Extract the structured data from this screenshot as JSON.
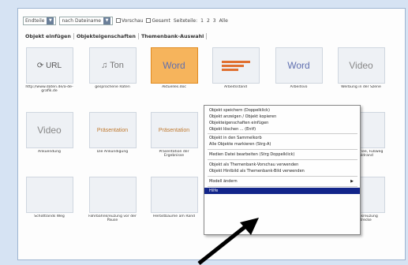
{
  "toolbar": {
    "sort_value": "Endteile",
    "order_value": "nach Dateiname",
    "checkbox_1": "Vorschau",
    "checkbox_2": "Gesamt",
    "pages_label": "Seiteteile:",
    "pages": [
      "1",
      "2",
      "3"
    ],
    "all_label": "Alle"
  },
  "tabs": [
    "Objekt einfügen",
    "Objekteigenschaften",
    "Themenbank-Auswahl"
  ],
  "tiles": [
    {
      "label": "http://www.daten.de/a-de-grafik.de",
      "icon": "URL"
    },
    {
      "label": "gesprochene Raten",
      "icon": "Ton"
    },
    {
      "label": "Aktuelles.doc",
      "icon": "Word"
    },
    {
      "label": "Arbeitsstand",
      "icon": ""
    },
    {
      "label": "Arbeitsvo",
      "icon": "Word"
    },
    {
      "label": "Werbung in der Szene",
      "icon": "Video"
    },
    {
      "label": "Ankuendung",
      "icon": "Video"
    },
    {
      "label": "Die Ankündigung",
      "icon": "Präsentation"
    },
    {
      "label": "Präsentation der Ergebnisse",
      "icon": "Präsentation"
    },
    {
      "label": "Herbstzeit am Anfang",
      "icon": ""
    },
    {
      "label": "Herbstwege",
      "icon": ""
    },
    {
      "label": "Herbst, Schnee, Fußweg am Waldrand",
      "icon": ""
    },
    {
      "label": "Schottlands Weg",
      "icon": ""
    },
    {
      "label": "Fahrbahnkreuzung vor der Pause",
      "icon": ""
    },
    {
      "label": "Herbstbäume am Rand",
      "icon": ""
    },
    {
      "label": "Bild",
      "icon": ""
    },
    {
      "label": "Pfad",
      "icon": ""
    },
    {
      "label": "Fahrbahnkreuzung Fahrstrecke",
      "icon": ""
    }
  ],
  "menu": {
    "items": [
      "Objekt speichern (Doppelklick)",
      "Objekt anzeigen / Objekt kopieren",
      "Objekteigenschaften einfügen",
      "Objekt löschen ... (Entf)",
      "Objekt in den Sammelkorb",
      "Alle Objekte markieren (Strg-A)",
      "Medien Datei bearbeiten (Strg Doppelklick)",
      "Objekt als Themenbank-Vorschau verwenden",
      "Objekt Hintbild als Themenbank-Bild verwenden",
      "Modell ändern",
      "Hilfe"
    ]
  }
}
